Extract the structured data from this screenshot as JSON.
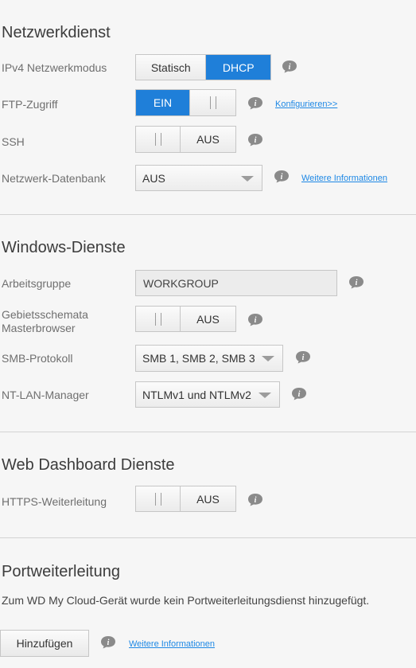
{
  "sections": {
    "network": {
      "title": "Netzwerkdienst",
      "ipv4": {
        "label": "IPv4 Netzwerkmodus",
        "option_static": "Statisch",
        "option_dhcp": "DHCP",
        "selected": "DHCP"
      },
      "ftp": {
        "label": "FTP-Zugriff",
        "state": "EIN",
        "link": "Konfigurieren>>"
      },
      "ssh": {
        "label": "SSH",
        "state": "AUS"
      },
      "db": {
        "label": "Netzwerk-Datenbank",
        "value": "AUS",
        "link": "Weitere Informationen"
      }
    },
    "windows": {
      "title": "Windows-Dienste",
      "workgroup": {
        "label": "Arbeitsgruppe",
        "value": "WORKGROUP"
      },
      "master": {
        "label_line1": "Gebietsschemata",
        "label_line2": "Masterbrowser",
        "state": "AUS"
      },
      "smb": {
        "label": "SMB-Protokoll",
        "value": "SMB 1, SMB 2, SMB 3"
      },
      "ntlm": {
        "label": "NT-LAN-Manager",
        "value": "NTLMv1 und NTLMv2"
      }
    },
    "web": {
      "title": "Web Dashboard Dienste",
      "https": {
        "label": "HTTPS-Weiterleitung",
        "state": "AUS"
      }
    },
    "port": {
      "title": "Portweiterleitung",
      "message": "Zum WD My Cloud-Gerät wurde kein Portweiterleitungsdienst hinzugefügt.",
      "add_button": "Hinzufügen",
      "link": "Weitere Informationen"
    }
  },
  "icons": {
    "info": "info-icon",
    "dropdown": "chevron-down-icon",
    "grip": "toggle-grip-icon"
  },
  "colors": {
    "accent": "#1f7fd9",
    "link": "#1e88e5",
    "background": "#f6f6f6"
  }
}
